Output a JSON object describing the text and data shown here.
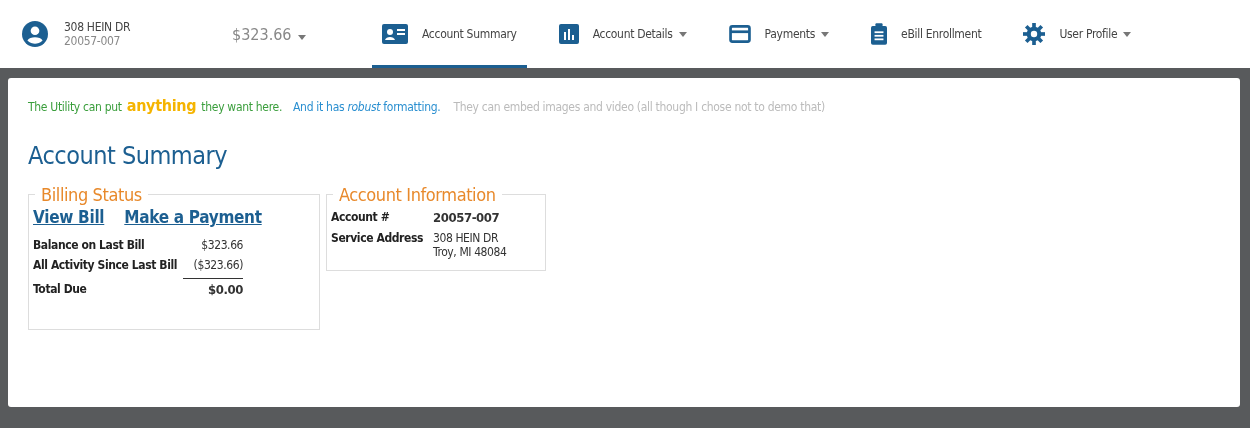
{
  "account": {
    "address": "308 HEIN DR",
    "number": "20057-007"
  },
  "balance_menu": {
    "label": "$323.66",
    "dropdown": true
  },
  "tabs": [
    {
      "label": "Account Summary",
      "dropdown": false,
      "selected": true
    },
    {
      "label": "Account Details",
      "dropdown": true,
      "selected": false
    },
    {
      "label": "Payments",
      "dropdown": true,
      "selected": false
    },
    {
      "label": "eBill Enrollment",
      "dropdown": false,
      "selected": false
    },
    {
      "label": "User Profile",
      "dropdown": true,
      "selected": false
    }
  ],
  "banner": [
    {
      "text": "The Utility can put",
      "color": "#3a9e3c",
      "kind": "plain"
    },
    {
      "text": "anything",
      "color": "#f5b400",
      "kind": "highlight"
    },
    {
      "text": "they want here.",
      "color": "#3a9e3c",
      "kind": "plain"
    },
    {
      "text": "And it has *robust* formatting.",
      "color": "#2a8fd0",
      "kind": "plain"
    },
    {
      "text": "They can embed images and video (all though I chose not to demo that)",
      "color": "#bbbbbb",
      "kind": "plain"
    }
  ],
  "page_title": "Account Summary",
  "billing_status": {
    "title": "Billing Status",
    "links": [
      "View Bill",
      "Make a Payment"
    ],
    "rows": [
      {
        "label": "Balance on Last Bill",
        "value": "$323.66",
        "kind": "plain"
      },
      {
        "label": "All Activity Since Last Bill",
        "value": "($323.66)",
        "kind": "plain"
      },
      {
        "label": "Total Due",
        "value": "$0.00",
        "kind": "total"
      }
    ]
  },
  "account_information": {
    "title": "Account Information",
    "rows": [
      {
        "label": "Account #",
        "lines": [
          "20057-007"
        ],
        "kind": "strong"
      },
      {
        "label": "Service Address",
        "lines": [
          "308 HEIN DR",
          "Troy, MI 48084"
        ],
        "kind": "plain"
      }
    ]
  }
}
